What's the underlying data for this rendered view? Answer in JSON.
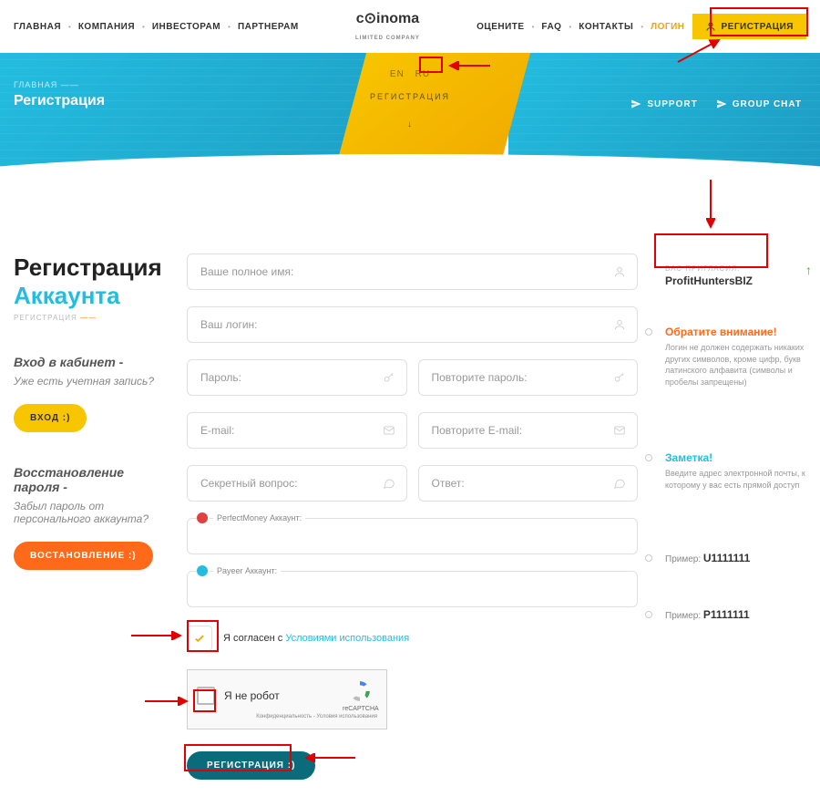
{
  "header": {
    "nav_left": [
      "ГЛАВНАЯ",
      "КОМПАНИЯ",
      "ИНВЕСТОРАМ",
      "ПАРТНЕРАМ"
    ],
    "logo_main": "c⊙inoma",
    "logo_sub": "LIMITED COMPANY",
    "nav_right": [
      "ОЦЕНИТЕ",
      "FAQ",
      "КОНТАКТЫ"
    ],
    "login": "ЛОГИН",
    "register": "РЕГИСТРАЦИЯ"
  },
  "hero": {
    "breadcrumb": "ГЛАВНАЯ",
    "title": "Регистрация",
    "lang_en": "EN",
    "lang_ru": "RU",
    "lang_reg": "РЕГИСТРАЦИЯ",
    "support": "SUPPORT",
    "group_chat": "GROUP CHAT"
  },
  "page": {
    "heading1": "Регистрация",
    "heading2": "Аккаунта",
    "tiny": "РЕГИСТРАЦИЯ"
  },
  "left": {
    "login_title": "Вход в кабинет -",
    "login_text": "Уже есть учетная запись?",
    "login_btn": "ВХОД  :)",
    "restore_title": "Восстановление пароля -",
    "restore_text": "Забыл пароль от персонального аккаунта?",
    "restore_btn": "ВОСТАНОВЛЕНИЕ  :)"
  },
  "form": {
    "fullname": "Ваше полное имя:",
    "login": "Ваш логин:",
    "password": "Пароль:",
    "password2": "Повторите пароль:",
    "email": "E-mail:",
    "email2": "Повторите E-mail:",
    "question": "Секретный вопрос:",
    "answer": "Ответ:",
    "pm_label": "PerfectMoney Аккаунт:",
    "payeer_label": "Payeer Аккаунт:",
    "agree_prefix": "Я согласен с ",
    "agree_link": "Условиями использования",
    "captcha_text": "Я не робот",
    "captcha_brand": "reCAPTCHA",
    "captcha_foot": "Конфиденциальность - Условия использования",
    "submit": "РЕГИСТРАЦИЯ  :)"
  },
  "right": {
    "invite_label": "ВАС ПРИГЛАСИЛ:",
    "invite_name": "ProfitHuntersBIZ",
    "note1_title": "Обратите внимание!",
    "note1_text": "Логин не должен содержать никаких других символов, кроме цифр, букв латинского алфавита (символы и пробелы запрещены)",
    "note2_title": "Заметка!",
    "note2_text": "Введите адрес электронной почты, к которому у вас есть прямой доступ",
    "ex_label": "Пример: ",
    "ex_pm": "U1111111",
    "ex_payeer": "P1111111"
  }
}
